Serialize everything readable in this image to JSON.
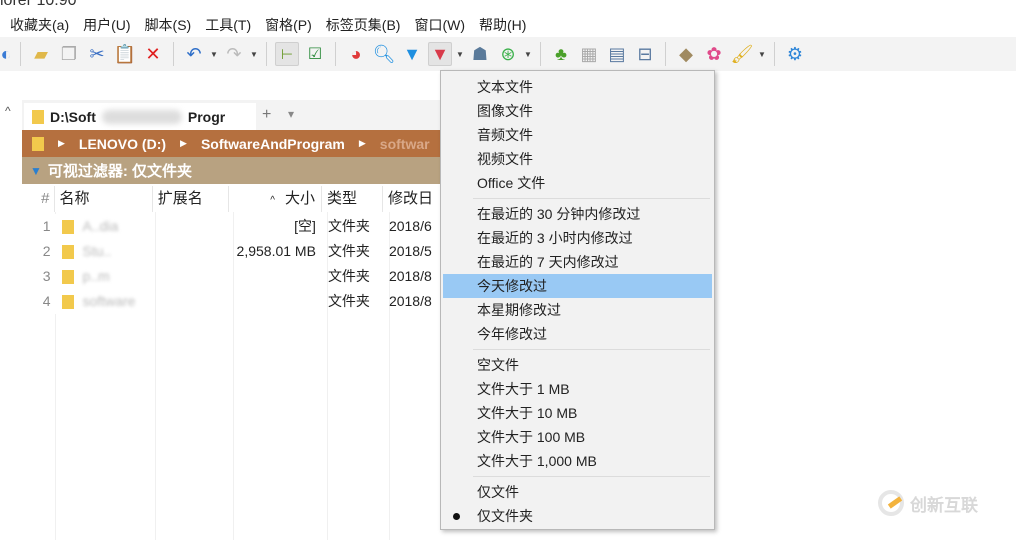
{
  "window_title": "lorer 10.90",
  "menu": [
    "收藏夹(a)",
    "用户(U)",
    "脚本(S)",
    "工具(T)",
    "窗格(P)",
    "标签页集(B)",
    "窗口(W)",
    "帮助(H)"
  ],
  "tab": {
    "label": "D:\\Soft",
    "label_end": "Progr",
    "add": "+",
    "dropdown": "▾"
  },
  "breadcrumb": [
    "LENOVO (D:)",
    "SoftwareAndProgram",
    "softwar"
  ],
  "filter": {
    "label": "可视过滤器: 仅文件夹"
  },
  "columns": {
    "num": "#",
    "name": "名称",
    "ext": "扩展名",
    "size": "大小",
    "type": "类型",
    "modified": "修改日"
  },
  "rows": [
    {
      "num": "1",
      "name": "A..dia",
      "size": "[空]",
      "type": "文件夹",
      "modified": "2018/6"
    },
    {
      "num": "2",
      "name": "Stu..",
      "size": "2,958.01 MB",
      "type": "文件夹",
      "modified": "2018/5"
    },
    {
      "num": "3",
      "name": "p..m",
      "size": "",
      "type": "文件夹",
      "modified": "2018/8"
    },
    {
      "num": "4",
      "name": "software",
      "size": "",
      "type": "文件夹",
      "modified": "2018/8"
    }
  ],
  "filter_menu": {
    "groups": [
      [
        "文本文件",
        "图像文件",
        "音频文件",
        "视频文件",
        "Office 文件"
      ],
      [
        "在最近的 30 分钟内修改过",
        "在最近的 3 小时内修改过",
        "在最近的 7 天内修改过",
        "今天修改过",
        "本星期修改过",
        "今年修改过"
      ],
      [
        "空文件",
        "文件大于 1 MB",
        "文件大于 10 MB",
        "文件大于 100 MB",
        "文件大于 1,000 MB"
      ],
      [
        "仅文件",
        "仅文件夹"
      ]
    ],
    "highlighted": "今天修改过",
    "checked": "仅文件夹"
  },
  "watermark": "创新互联"
}
